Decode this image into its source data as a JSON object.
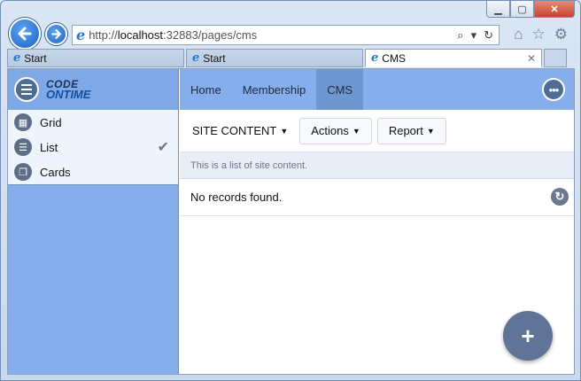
{
  "browser": {
    "address": {
      "scheme": "http://",
      "host": "localhost",
      "rest": ":32883/pages/cms"
    },
    "tabs": [
      {
        "label": "Start",
        "active": false
      },
      {
        "label": "Start",
        "active": false
      },
      {
        "label": "CMS",
        "active": true,
        "close": "✕"
      }
    ],
    "caption": {
      "min": "▁",
      "max": "▢",
      "close": "✕"
    }
  },
  "sidebar": {
    "logo": {
      "line1": "CODE",
      "line2": "ONTIME"
    },
    "items": [
      {
        "label": "Grid",
        "icon": "grid-icon"
      },
      {
        "label": "List",
        "icon": "list-icon",
        "selected": true
      },
      {
        "label": "Cards",
        "icon": "cards-icon"
      }
    ]
  },
  "topnav": {
    "items": [
      {
        "label": "Home"
      },
      {
        "label": "Membership"
      },
      {
        "label": "CMS",
        "active": true
      }
    ]
  },
  "actionbar": {
    "view_label": "SITE CONTENT",
    "actions_label": "Actions",
    "report_label": "Report"
  },
  "main": {
    "description": "This is a list of site content.",
    "empty_message": "No records found."
  },
  "colors": {
    "sidebar_bg": "#86aeea",
    "nav_active": "#6e96cf",
    "fab_bg": "#5f7496"
  }
}
